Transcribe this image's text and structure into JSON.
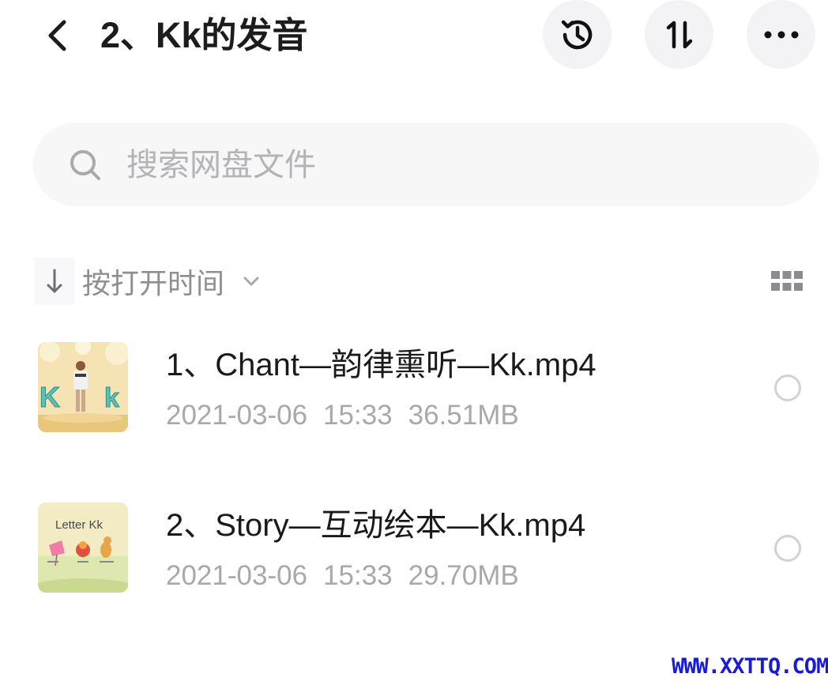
{
  "header": {
    "title": "2、Kk的发音",
    "back_icon": "chevron-left-icon",
    "history_icon": "history-icon",
    "sort_icon": "sort-updown-icon",
    "more_icon": "more-dots-icon"
  },
  "search": {
    "placeholder": "搜索网盘文件",
    "value": ""
  },
  "sort": {
    "label": "按打开时间",
    "direction_icon": "arrow-down-icon",
    "dropdown_icon": "chevron-down-icon",
    "view_icon": "grid-view-icon"
  },
  "files": [
    {
      "name": "1、Chant—韵律熏听—Kk.mp4",
      "date": "2021-03-06",
      "time": "15:33",
      "size": "36.51MB",
      "selected": false
    },
    {
      "name": "2、Story—互动绘本—Kk.mp4",
      "date": "2021-03-06",
      "time": "15:33",
      "size": "29.70MB",
      "selected": false,
      "thumb_text": "Letter Kk"
    }
  ],
  "watermark": "WWW.XXTTQ.COM",
  "colors": {
    "text_primary": "#1a1a1a",
    "text_secondary": "#a9a9ad",
    "button_bg": "#f3f3f5",
    "search_bg": "#f7f7f8",
    "watermark": "#1a1adb"
  }
}
